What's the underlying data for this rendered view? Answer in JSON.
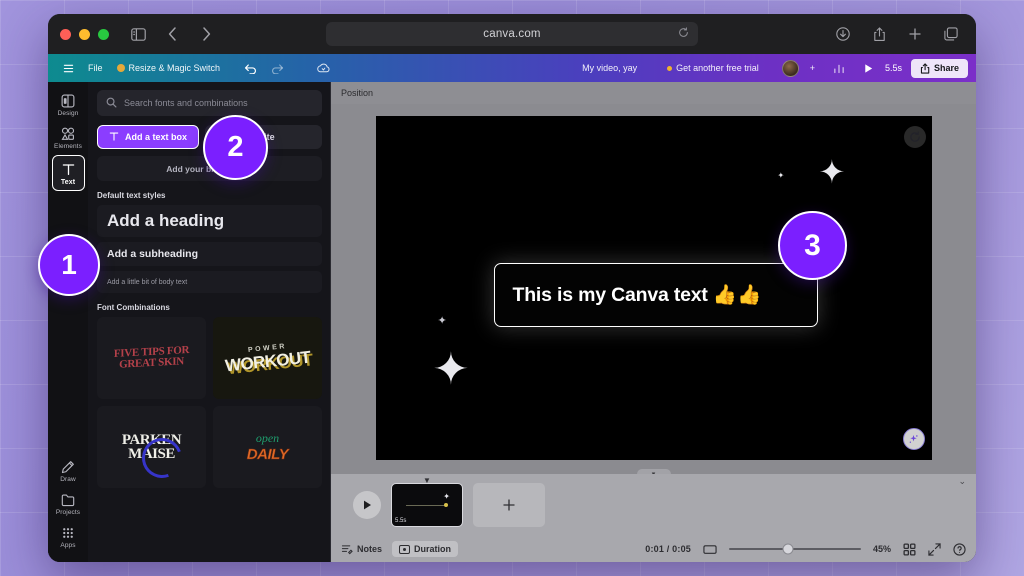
{
  "browser": {
    "url": "canva.com",
    "icons": {
      "sidebar_toggle": "sidebar-toggle-icon",
      "back": "back-arrow-icon",
      "forward": "forward-arrow-icon",
      "shield": "privacy-shield-icon",
      "reload": "reload-icon",
      "download": "download-icon",
      "share": "share-icon",
      "new_tab": "plus-icon",
      "tabs": "tab-overview-icon"
    }
  },
  "topbar": {
    "menu": "hamburger-menu-icon",
    "file": "File",
    "resize": "Resize & Magic Switch",
    "undo": "undo-icon",
    "redo": "redo-icon",
    "cloud": "cloud-saved-icon",
    "doc_title": "My video, yay",
    "trial": "Get another free trial",
    "add_collaborator": "+",
    "insights": "insights-icon",
    "play": "play-icon",
    "duration": "5.5s",
    "share": "Share"
  },
  "rail": {
    "items": [
      {
        "label": "Design",
        "icon": "design-icon",
        "active": false
      },
      {
        "label": "Elements",
        "icon": "elements-icon",
        "active": false
      },
      {
        "label": "Text",
        "icon": "text-icon",
        "active": true
      },
      {
        "label": "Draw",
        "icon": "draw-icon",
        "active": false
      },
      {
        "label": "Projects",
        "icon": "projects-icon",
        "active": false
      },
      {
        "label": "Apps",
        "icon": "apps-icon",
        "active": false
      }
    ]
  },
  "panel": {
    "search_placeholder": "Search fonts and combinations",
    "add_text_box": "Add a text box",
    "magic_write": "Write",
    "brand_fonts": "Add your brand fonts",
    "default_styles_heading": "Default text styles",
    "styles": {
      "heading": "Add a heading",
      "subheading": "Add a subheading",
      "body": "Add a little bit of body text"
    },
    "combinations_heading": "Font Combinations",
    "combinations": [
      {
        "sub": "",
        "text": "FIVE TIPS FOR GREAT SKIN"
      },
      {
        "sub": "POWER",
        "text": "WORKOUT"
      },
      {
        "sub": "",
        "text": "PARKEN MAISE"
      },
      {
        "sub": "open",
        "text": "DAILY"
      }
    ]
  },
  "canvas": {
    "toolbar_label": "Position",
    "text_content": "This is my Canva text 👍👍",
    "animate_icon": "animate-refresh-icon",
    "magic_icon": "magic-sparkle-icon"
  },
  "bottom": {
    "play": "play-icon",
    "page_duration": "5.5s",
    "add_page": "+",
    "notes": "Notes",
    "duration": "Duration",
    "time_code": "0:01 / 0:05",
    "zoom_percent": "45%",
    "fit_icon": "fit-screen-icon",
    "grid_icon": "grid-view-icon",
    "expand_icon": "fullscreen-icon",
    "help_icon": "help-icon"
  },
  "steps": {
    "one": "1",
    "two": "2",
    "three": "3"
  },
  "colors": {
    "accent_purple": "#8b3dff",
    "badge_purple": "#7b1fff",
    "canvas_black": "#000000",
    "panel_dark": "#15151a"
  }
}
